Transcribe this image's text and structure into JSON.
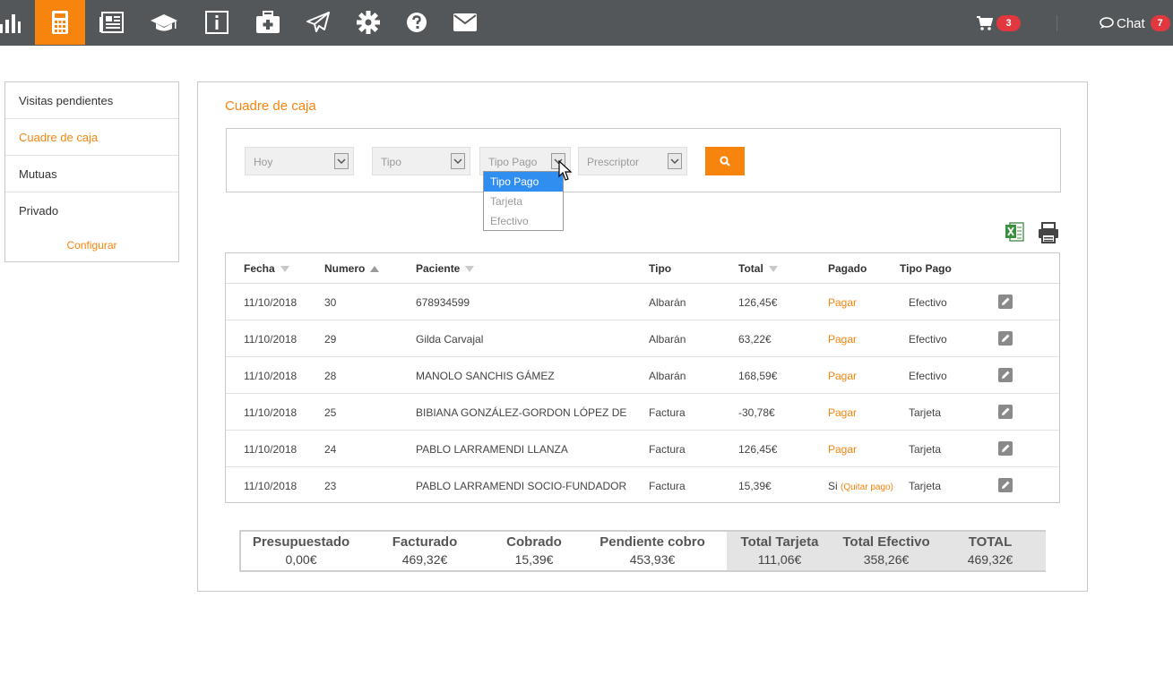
{
  "topbar": {
    "icons": [
      "bar-chart-icon",
      "calculator-icon",
      "newspaper-icon",
      "graduation-cap-icon",
      "info-icon",
      "medkit-icon",
      "paper-plane-icon",
      "gear-icon",
      "question-icon",
      "envelope-icon"
    ],
    "cart_count": "3",
    "chat_label": "Chat",
    "chat_count": "7",
    "accent": "#f7840d",
    "bar_color": "#545759"
  },
  "sidebar": {
    "items": [
      {
        "label": "Visitas pendientes"
      },
      {
        "label": "Cuadre de caja"
      },
      {
        "label": "Mutuas"
      },
      {
        "label": "Privado"
      }
    ],
    "config_label": "Configurar"
  },
  "panel": {
    "title": "Cuadre de caja",
    "filters": {
      "date": "Hoy",
      "tipo": "Tipo",
      "tipo_pago": "Tipo Pago",
      "prescriptor": "Prescriptor"
    },
    "dropdown_options": [
      "Tipo Pago",
      "Tarjeta",
      "Efectivo"
    ]
  },
  "table": {
    "headers": [
      "Fecha",
      "Numero",
      "Paciente",
      "Tipo",
      "Total",
      "Pagado",
      "Tipo Pago"
    ],
    "rows": [
      {
        "fecha": "11/10/2018",
        "numero": "30",
        "paciente": "678934599",
        "tipo": "Albarán",
        "total": "126,45€",
        "pagado": "Pagar",
        "tipo_pago": "Efectivo"
      },
      {
        "fecha": "11/10/2018",
        "numero": "29",
        "paciente": "Gilda Carvajal",
        "tipo": "Albarán",
        "total": "63,22€",
        "pagado": "Pagar",
        "tipo_pago": "Efectivo"
      },
      {
        "fecha": "11/10/2018",
        "numero": "28",
        "paciente": "MANOLO SANCHIS GÁMEZ",
        "tipo": "Albarán",
        "total": "168,59€",
        "pagado": "Pagar",
        "tipo_pago": "Efectivo"
      },
      {
        "fecha": "11/10/2018",
        "numero": "25",
        "paciente": "BIBIANA GONZÁLEZ-GORDON LÓPEZ DE",
        "tipo": "Factura",
        "total": "-30,78€",
        "pagado": "Pagar",
        "tipo_pago": "Tarjeta"
      },
      {
        "fecha": "11/10/2018",
        "numero": "24",
        "paciente": "PABLO LARRAMENDI LLANZA",
        "tipo": "Factura",
        "total": "126,45€",
        "pagado": "Pagar",
        "tipo_pago": "Tarjeta"
      },
      {
        "fecha": "11/10/2018",
        "numero": "23",
        "paciente": "PABLO LARRAMENDI SOCIO-FUNDADOR",
        "tipo": "Factura",
        "total": "15,39€",
        "pagado": "Si",
        "pagado_extra": "(Quitar pago)",
        "tipo_pago": "Tarjeta"
      }
    ]
  },
  "summary": {
    "items": [
      {
        "label": "Presupuestado",
        "value": "0,00€"
      },
      {
        "label": "Facturado",
        "value": "469,32€"
      },
      {
        "label": "Cobrado",
        "value": "15,39€"
      },
      {
        "label": "Pendiente cobro",
        "value": "453,93€"
      },
      {
        "label": "Total Tarjeta",
        "value": "111,06€"
      },
      {
        "label": "Total Efectivo",
        "value": "358,26€"
      },
      {
        "label": "TOTAL",
        "value": "469,32€"
      }
    ]
  }
}
